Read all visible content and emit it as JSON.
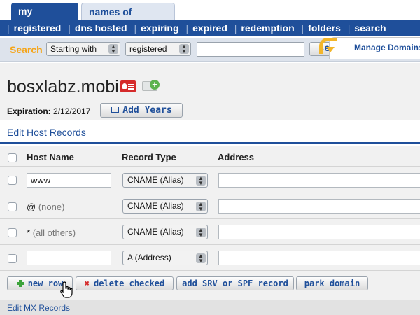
{
  "tabs": {
    "active": "my domains",
    "inactive": "names of interest"
  },
  "nav": {
    "items": [
      "registered",
      "dns hosted",
      "expiring",
      "expired",
      "redemption",
      "folders",
      "search"
    ]
  },
  "search": {
    "label": "Search",
    "mode_select": "Starting with",
    "scope_select": "registered",
    "input_value": "",
    "button": "search"
  },
  "domain": {
    "name": "bosxlabz.mobi",
    "expiration_label": "Expiration:",
    "expiration_date": "2/12/2017",
    "add_years_button": "Add Years",
    "manage_tab": "Manage Domain:"
  },
  "host_records": {
    "title": "Edit Host Records",
    "columns": [
      "Host Name",
      "Record Type",
      "Address"
    ],
    "rows": [
      {
        "host": "www",
        "host_muted": "",
        "host_editable": true,
        "record_type": "CNAME (Alias)",
        "address": ""
      },
      {
        "host": "@",
        "host_muted": "(none)",
        "host_editable": false,
        "record_type": "CNAME (Alias)",
        "address": ""
      },
      {
        "host": "*",
        "host_muted": "(all others)",
        "host_editable": false,
        "record_type": "CNAME (Alias)",
        "address": ""
      },
      {
        "host": "",
        "host_muted": "",
        "host_editable": true,
        "record_type": "A (Address)",
        "address": ""
      }
    ]
  },
  "actions": {
    "new_row": "new row",
    "delete_checked": "delete checked",
    "add_srv": "add SRV or SPF record",
    "park_domain": "park domain"
  },
  "mx": {
    "title": "Edit MX Records"
  },
  "colors": {
    "brand_blue": "#1f4f9a",
    "search_orange": "#f5a51a",
    "panel_gray": "#f1f1f1"
  }
}
